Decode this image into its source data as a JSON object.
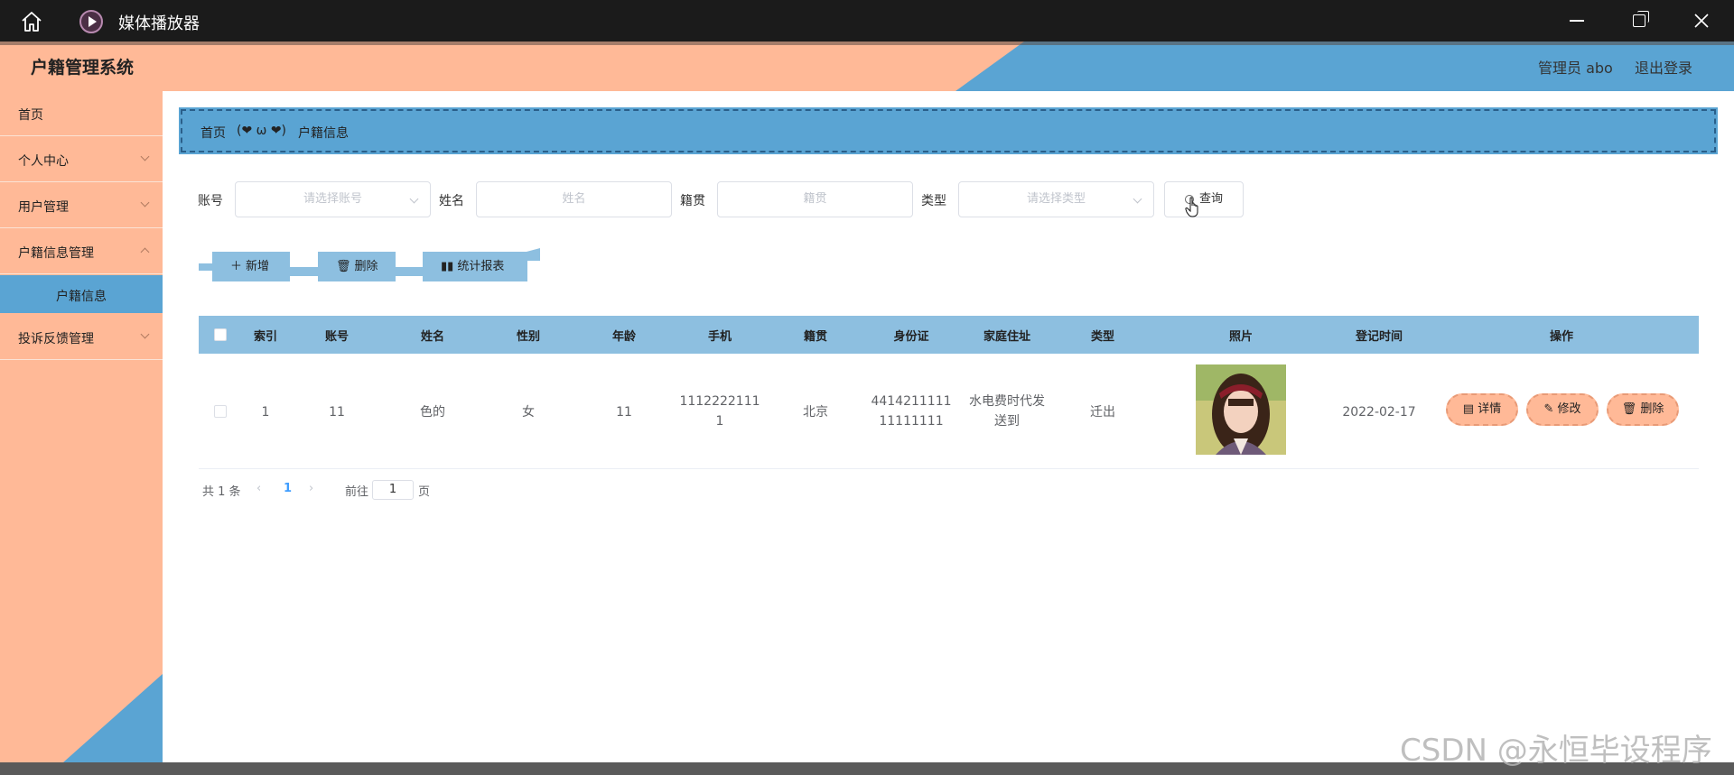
{
  "window": {
    "title": "媒体播放器",
    "icons": [
      "home-icon",
      "play-icon",
      "minimize-icon",
      "maximize-icon",
      "close-icon"
    ]
  },
  "header": {
    "system_title": "户籍管理系统",
    "admin_label": "管理员 abo",
    "logout_label": "退出登录"
  },
  "sidebar": {
    "items": [
      {
        "label": "首页"
      },
      {
        "label": "个人中心"
      },
      {
        "label": "用户管理"
      },
      {
        "label": "户籍信息管理"
      },
      {
        "label": "户籍信息"
      },
      {
        "label": "投诉反馈管理"
      }
    ]
  },
  "breadcrumb": {
    "home": "首页",
    "separator": "(❤ ω ❤)",
    "current": "户籍信息"
  },
  "filters": {
    "account": {
      "label": "账号",
      "placeholder": "请选择账号"
    },
    "name": {
      "label": "姓名",
      "placeholder": "姓名"
    },
    "origin": {
      "label": "籍贯",
      "placeholder": "籍贯"
    },
    "type": {
      "label": "类型",
      "placeholder": "请选择类型"
    },
    "query_label": "查询"
  },
  "actions": {
    "add_label": "新增",
    "delete_label": "删除",
    "report_label": "统计报表"
  },
  "table": {
    "headers": [
      "索引",
      "账号",
      "姓名",
      "性别",
      "年龄",
      "手机",
      "籍贯",
      "身份证",
      "家庭住址",
      "类型",
      "照片",
      "登记时间",
      "操作"
    ],
    "rows": [
      {
        "index": "1",
        "account": "11",
        "name": "色的",
        "gender": "女",
        "age": "11",
        "phone_line1": "1112222111",
        "phone_line2": "1",
        "origin": "北京",
        "id_line1": "4414211111",
        "id_line2": "11111111",
        "address_line1": "水电费时代发",
        "address_line2": "送到",
        "type": "迁出",
        "reg_time": "2022-02-17",
        "detail_label": "详情",
        "edit_label": "修改",
        "delete_label": "删除"
      }
    ]
  },
  "pagination": {
    "total": "共 1 条",
    "current_page": "1",
    "goto_label": "前往",
    "goto_value": "1",
    "page_suffix": "页"
  },
  "watermark": "CSDN @永恒毕设程序",
  "colors": {
    "peach": "#ffb997",
    "blue": "#5aa4d3",
    "light_blue": "#8dbfe0",
    "titlebar": "#1b1b1b"
  }
}
